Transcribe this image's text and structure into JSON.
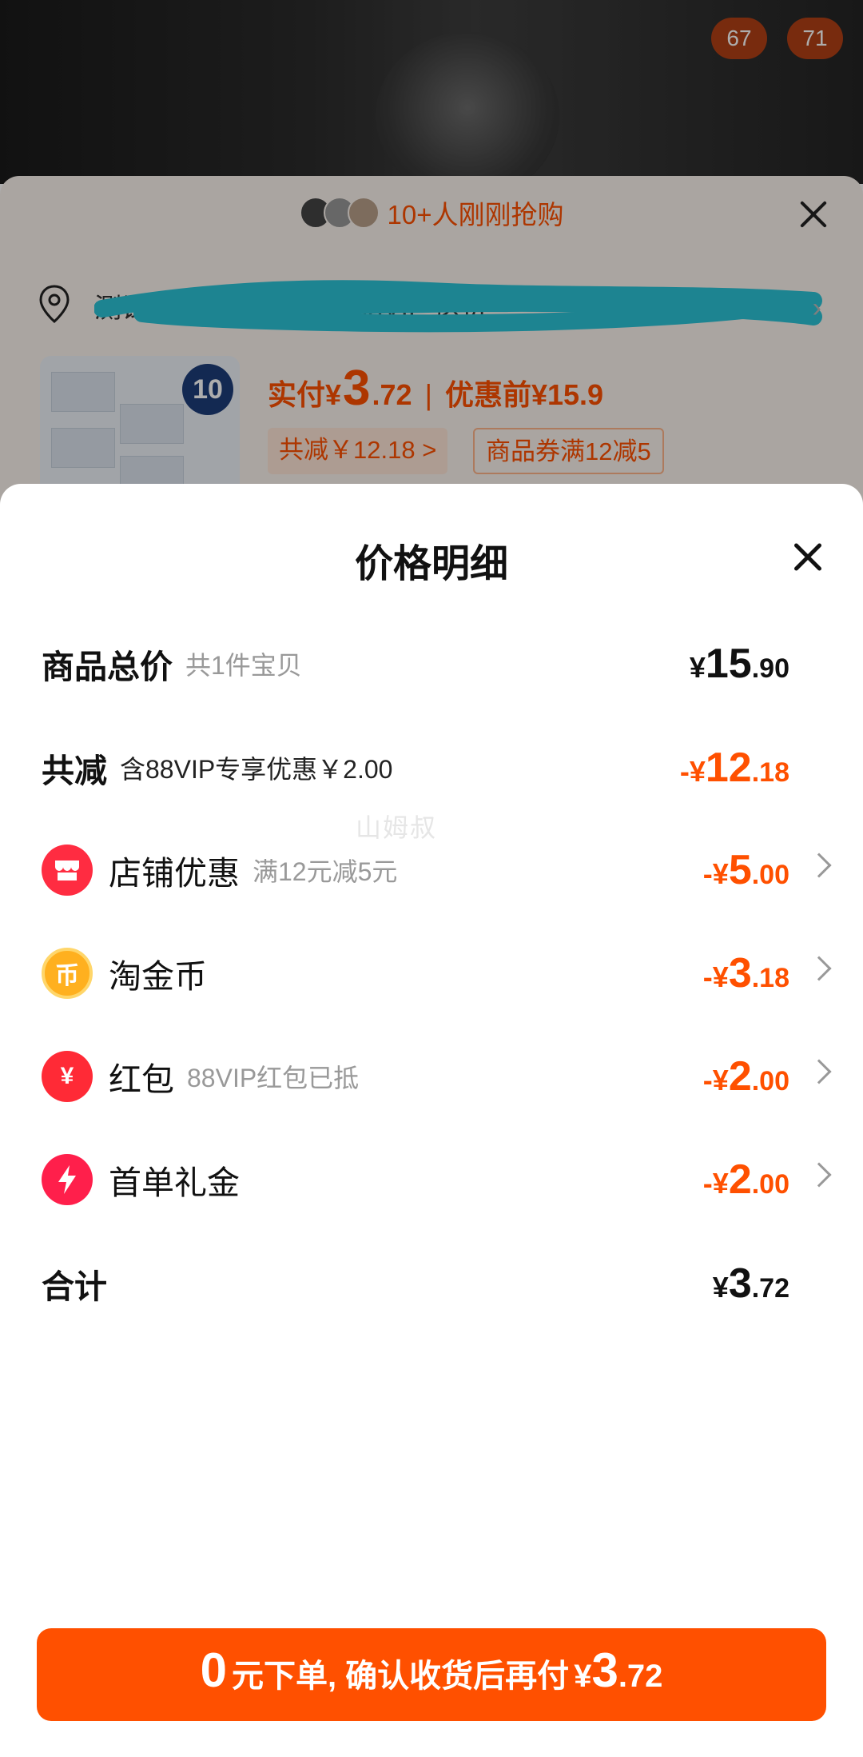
{
  "background": {
    "counters": [
      "67",
      "71"
    ],
    "buyers_text": "10+人刚刚抢购",
    "address_text": "测试1 广... 机场 快递 88VIP 送货",
    "thumb_badge": "10",
    "paid_label": "实付",
    "paid_currency": "¥",
    "paid_int": "3",
    "paid_dec": ".72",
    "before_label": "优惠前",
    "before_value": "¥15.9",
    "tag_discount": "共减￥12.18 >",
    "tag_coupon": "商品券满12减5"
  },
  "sheet": {
    "title": "价格明细",
    "watermark": "山姆叔",
    "rows": [
      {
        "label": "商品总价",
        "sub": "共1件宝贝",
        "cur": "¥",
        "int": "15",
        "dec": ".90"
      },
      {
        "label": "共减",
        "sub": "含88VIP专享优惠￥2.00",
        "cur": "-¥",
        "int": "12",
        "dec": ".18"
      },
      {
        "label": "店铺优惠",
        "sub": "满12元减5元",
        "cur": "-¥",
        "int": "5",
        "dec": ".00",
        "icon": "shop-icon"
      },
      {
        "label": "淘金币",
        "sub": "",
        "cur": "-¥",
        "int": "3",
        "dec": ".18",
        "icon": "coin-icon",
        "icon_glyph": "币"
      },
      {
        "label": "红包",
        "sub": "88VIP红包已抵",
        "cur": "-¥",
        "int": "2",
        "dec": ".00",
        "icon": "red-packet-icon",
        "icon_glyph": "¥"
      },
      {
        "label": "首单礼金",
        "sub": "",
        "cur": "-¥",
        "int": "2",
        "dec": ".00",
        "icon": "lightning-icon"
      },
      {
        "label": "合计",
        "sub": "",
        "cur": "¥",
        "int": "3",
        "dec": ".72"
      }
    ]
  },
  "cta": {
    "zero": "0",
    "text": "元下单, 确认收货后再付",
    "cur": "¥",
    "int": "3",
    "dec": ".72"
  },
  "colors": {
    "accent": "#ff5000",
    "icon_red": "#ff2c41",
    "coin": "#ffb01f"
  }
}
